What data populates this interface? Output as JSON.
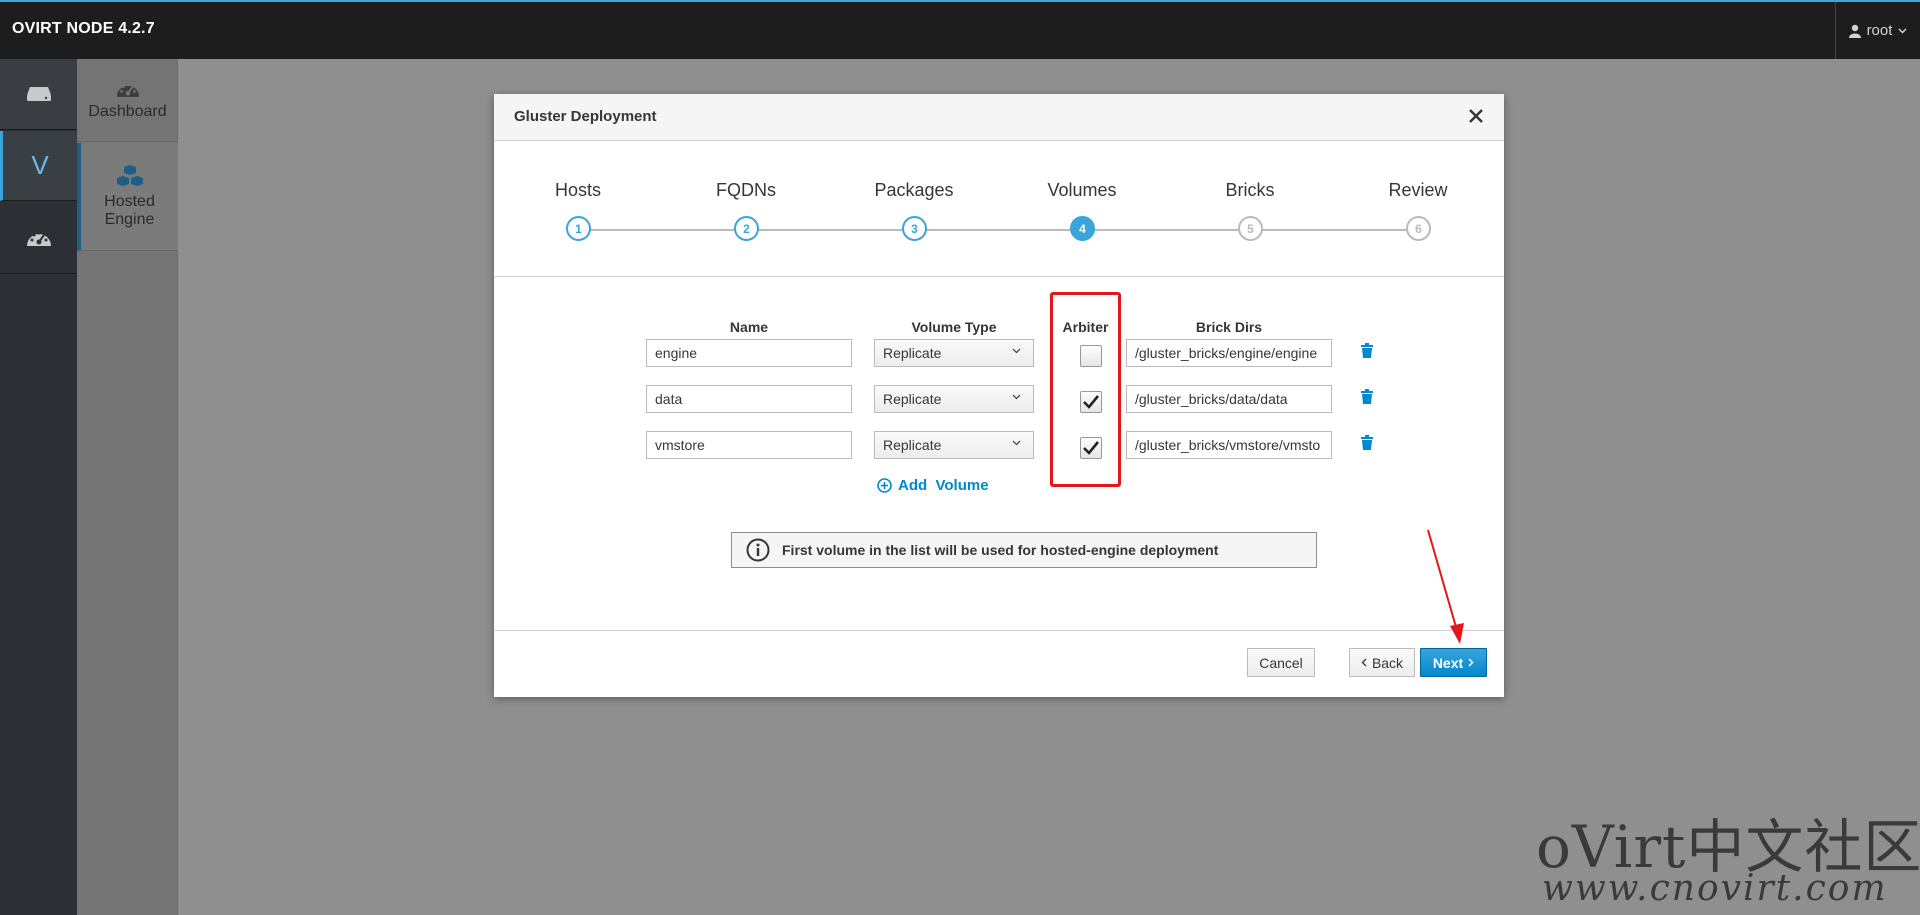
{
  "app": {
    "brand": "OVIRT NODE 4.2.7",
    "user": "root"
  },
  "vnav": {
    "item2_label": "V"
  },
  "subnav": {
    "items": [
      {
        "label": "Dashboard"
      },
      {
        "label_line1": "Hosted",
        "label_line2": "Engine"
      }
    ]
  },
  "modal": {
    "title": "Gluster Deployment",
    "steps": [
      {
        "label": "Hosts",
        "number": "1",
        "state": "done"
      },
      {
        "label": "FQDNs",
        "number": "2",
        "state": "done"
      },
      {
        "label": "Packages",
        "number": "3",
        "state": "done"
      },
      {
        "label": "Volumes",
        "number": "4",
        "state": "current"
      },
      {
        "label": "Bricks",
        "number": "5",
        "state": "todo"
      },
      {
        "label": "Review",
        "number": "6",
        "state": "todo"
      }
    ],
    "columns": {
      "name": "Name",
      "volume_type": "Volume Type",
      "arbiter": "Arbiter",
      "brick_dirs": "Brick Dirs"
    },
    "volumes": [
      {
        "name": "engine",
        "type": "Replicate",
        "arbiter": false,
        "brick_dir": "/gluster_bricks/engine/engine"
      },
      {
        "name": "data",
        "type": "Replicate",
        "arbiter": true,
        "brick_dir": "/gluster_bricks/data/data"
      },
      {
        "name": "vmstore",
        "type": "Replicate",
        "arbiter": true,
        "brick_dir": "/gluster_bricks/vmstore/vmsto"
      }
    ],
    "add_volume_label": "Add  Volume",
    "info_text": "First volume in the list will be used for hosted-engine deployment",
    "buttons": {
      "cancel": "Cancel",
      "back": "Back",
      "next": "Next"
    }
  },
  "watermark": {
    "line1": "oVirt中文社区",
    "line2": "www.cnovirt.com"
  },
  "colors": {
    "accent": "#39a5dc",
    "primary": "#0088ce",
    "highlight": "#e3161c",
    "navbar": "#1d1d1d"
  }
}
